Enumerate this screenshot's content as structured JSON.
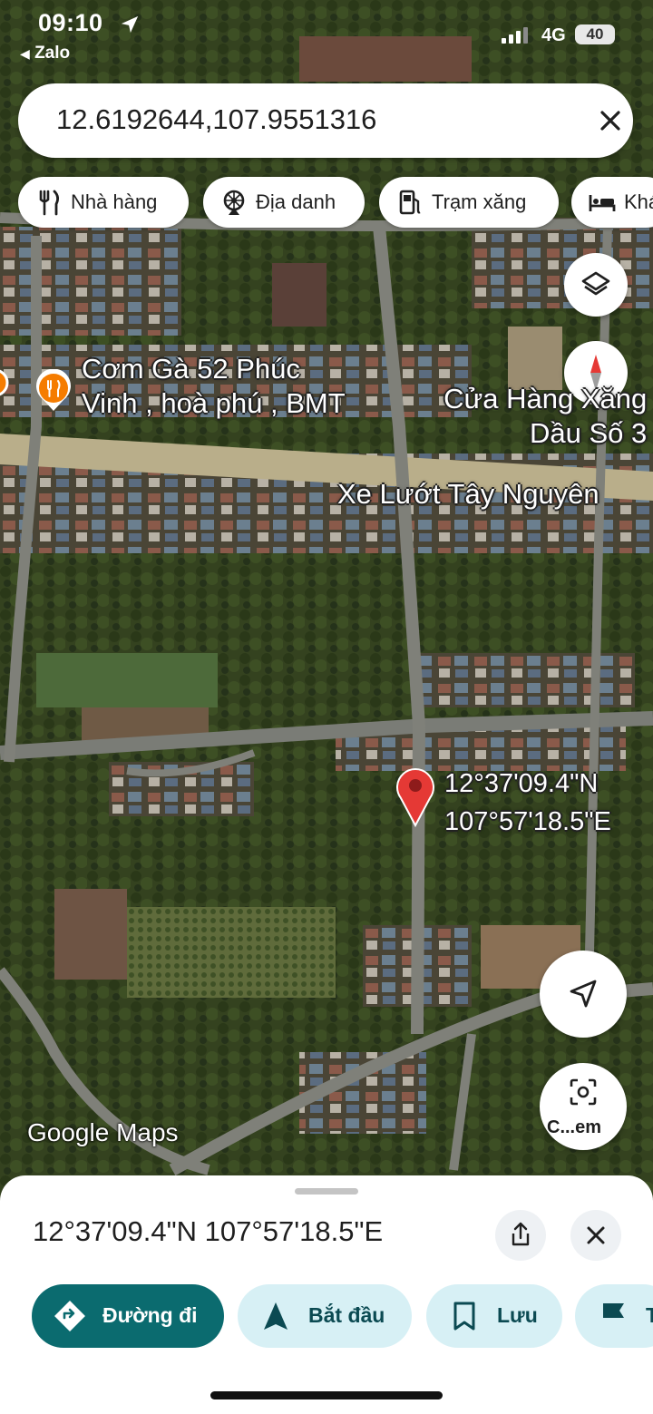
{
  "status_bar": {
    "time": "09:10",
    "back_app": "Zalo",
    "network": "4G",
    "battery": "40"
  },
  "search": {
    "value": "12.6192644,107.9551316"
  },
  "chips": [
    {
      "label": "Nhà hàng",
      "icon": "restaurant-icon"
    },
    {
      "label": "Địa danh",
      "icon": "landmark-icon"
    },
    {
      "label": "Trạm xăng",
      "icon": "gas-station-icon"
    },
    {
      "label": "Khách sạn",
      "icon": "hotel-icon"
    }
  ],
  "map": {
    "type": "satellite",
    "places": {
      "com_ga": {
        "line1": "Cơm Gà 52 Phúc",
        "line2": "Vinh , hoà phú , BMT"
      },
      "cua_hang": {
        "line1": "Cửa Hàng Xăng",
        "line2": "Dầu Số 3"
      },
      "xe_luot": {
        "line1": "Xe Lướt Tây Nguyên"
      }
    },
    "pin": {
      "lat_label": "12°37'09.4\"N",
      "lng_label": "107°57'18.5\"E"
    },
    "attribution": "Google Maps",
    "lens_label": "C...em"
  },
  "sheet": {
    "title": "12°37'09.4\"N 107°57'18.5\"E",
    "actions": [
      {
        "label": "Đường đi",
        "icon": "directions-icon"
      },
      {
        "label": "Bắt đầu",
        "icon": "navigation-icon"
      },
      {
        "label": "Lưu",
        "icon": "bookmark-icon"
      },
      {
        "label": "Thêm",
        "icon": "flag-icon"
      }
    ]
  },
  "colors": {
    "accent": "#0b6b6f",
    "chip_bg": "#d7f0f5",
    "pin": "#e53935"
  }
}
